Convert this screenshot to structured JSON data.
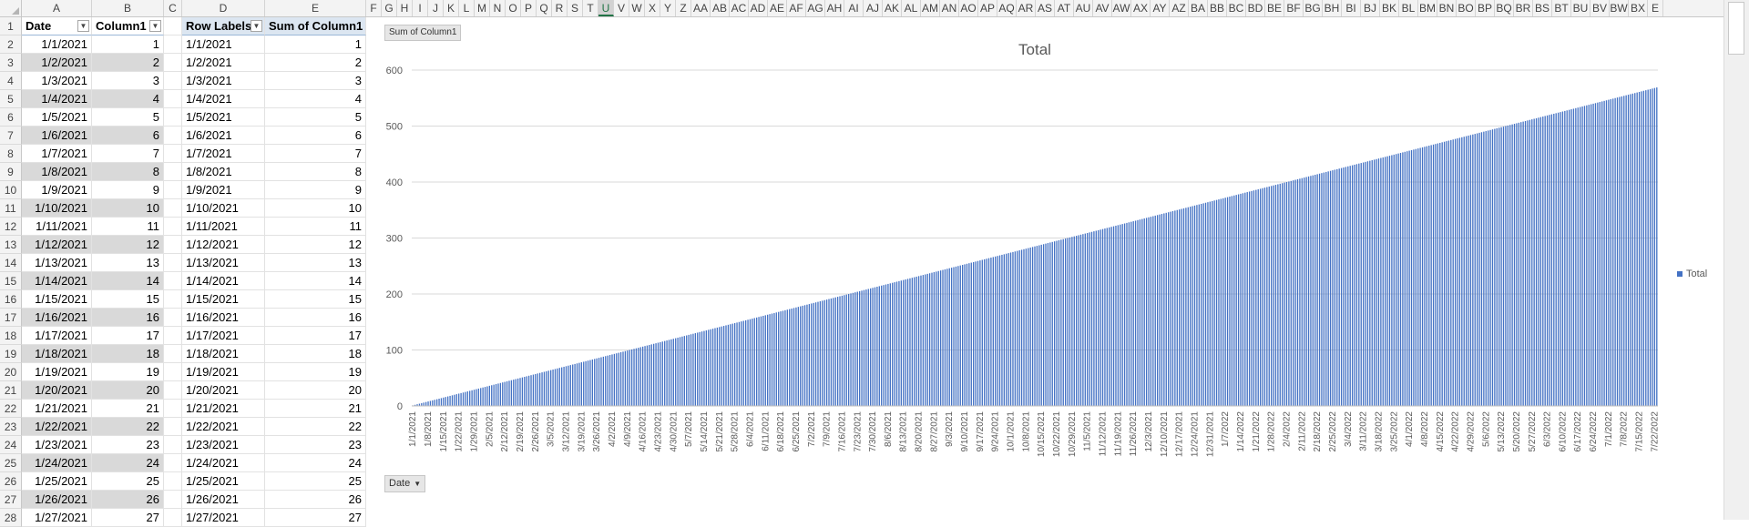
{
  "grid": {
    "columns": [
      "A",
      "B",
      "C",
      "D",
      "E",
      "F",
      "G",
      "H",
      "I",
      "J",
      "K",
      "L",
      "M",
      "N",
      "O",
      "P",
      "Q",
      "R",
      "S",
      "T",
      "U",
      "V",
      "W",
      "X",
      "Y",
      "Z",
      "AA",
      "AB",
      "AC",
      "AD",
      "AE",
      "AF",
      "AG",
      "AH",
      "AI",
      "AJ",
      "AK",
      "AL",
      "AM",
      "AN",
      "AO",
      "AP",
      "AQ",
      "AR",
      "AS",
      "AT",
      "AU",
      "AV",
      "AW",
      "AX",
      "AY",
      "AZ",
      "BA",
      "BB",
      "BC",
      "BD",
      "BE",
      "BF",
      "BG",
      "BH",
      "BI",
      "BJ",
      "BK",
      "BL",
      "BM",
      "BN",
      "BO",
      "BP",
      "BQ",
      "BR",
      "BS",
      "BT",
      "BU",
      "BV",
      "BW",
      "BX",
      "E"
    ],
    "selected_column": "U"
  },
  "table": {
    "header_date": "Date",
    "header_col1": "Column1",
    "rows": [
      {
        "date": "1/1/2021",
        "v": "1"
      },
      {
        "date": "1/2/2021",
        "v": "2"
      },
      {
        "date": "1/3/2021",
        "v": "3"
      },
      {
        "date": "1/4/2021",
        "v": "4"
      },
      {
        "date": "1/5/2021",
        "v": "5"
      },
      {
        "date": "1/6/2021",
        "v": "6"
      },
      {
        "date": "1/7/2021",
        "v": "7"
      },
      {
        "date": "1/8/2021",
        "v": "8"
      },
      {
        "date": "1/9/2021",
        "v": "9"
      },
      {
        "date": "1/10/2021",
        "v": "10"
      },
      {
        "date": "1/11/2021",
        "v": "11"
      },
      {
        "date": "1/12/2021",
        "v": "12"
      },
      {
        "date": "1/13/2021",
        "v": "13"
      },
      {
        "date": "1/14/2021",
        "v": "14"
      },
      {
        "date": "1/15/2021",
        "v": "15"
      },
      {
        "date": "1/16/2021",
        "v": "16"
      },
      {
        "date": "1/17/2021",
        "v": "17"
      },
      {
        "date": "1/18/2021",
        "v": "18"
      },
      {
        "date": "1/19/2021",
        "v": "19"
      },
      {
        "date": "1/20/2021",
        "v": "20"
      },
      {
        "date": "1/21/2021",
        "v": "21"
      },
      {
        "date": "1/22/2021",
        "v": "22"
      },
      {
        "date": "1/23/2021",
        "v": "23"
      },
      {
        "date": "1/24/2021",
        "v": "24"
      },
      {
        "date": "1/25/2021",
        "v": "25"
      },
      {
        "date": "1/26/2021",
        "v": "26"
      },
      {
        "date": "1/27/2021",
        "v": "27"
      }
    ]
  },
  "pivot": {
    "header_labels": "Row Labels",
    "header_sum": "Sum of Column1"
  },
  "chart_fields": {
    "values_button": "Sum of Column1",
    "axis_button": "Date"
  },
  "chart_data": {
    "type": "bar",
    "title": "Total",
    "legend": "Total",
    "legend_position": "right",
    "series": [
      {
        "name": "Total",
        "values": "y = day index, rising linearly from 1 on 1/1/2021 to 569 on 7/23/2022"
      }
    ],
    "x": {
      "start": "1/1/2021",
      "end": "7/23/2022",
      "count": 569
    },
    "ylim": [
      0,
      600
    ],
    "yticks": [
      "0",
      "100",
      "200",
      "300",
      "400",
      "500",
      "600"
    ],
    "xtick_labels": [
      "1/1/2021",
      "1/8/2021",
      "1/15/2021",
      "1/22/2021",
      "1/29/2021",
      "2/5/2021",
      "2/12/2021",
      "2/19/2021",
      "2/26/2021",
      "3/5/2021",
      "3/12/2021",
      "3/19/2021",
      "3/26/2021",
      "4/2/2021",
      "4/9/2021",
      "4/16/2021",
      "4/23/2021",
      "4/30/2021",
      "5/7/2021",
      "5/14/2021",
      "5/21/2021",
      "5/28/2021",
      "6/4/2021",
      "6/11/2021",
      "6/18/2021",
      "6/25/2021",
      "7/2/2021",
      "7/9/2021",
      "7/16/2021",
      "7/23/2021",
      "7/30/2021",
      "8/6/2021",
      "8/13/2021",
      "8/20/2021",
      "8/27/2021",
      "9/3/2021",
      "9/10/2021",
      "9/17/2021",
      "9/24/2021",
      "10/1/2021",
      "10/8/2021",
      "10/15/2021",
      "10/22/2021",
      "10/29/2021",
      "11/5/2021",
      "11/12/2021",
      "11/19/2021",
      "11/26/2021",
      "12/3/2021",
      "12/10/2021",
      "12/17/2021",
      "12/24/2021",
      "12/31/2021",
      "1/7/2022",
      "1/14/2022",
      "1/21/2022",
      "1/28/2022",
      "2/4/2022",
      "2/11/2022",
      "2/18/2022",
      "2/25/2022",
      "3/4/2022",
      "3/11/2022",
      "3/18/2022",
      "3/25/2022",
      "4/1/2022",
      "4/8/2022",
      "4/15/2022",
      "4/22/2022",
      "4/29/2022",
      "5/6/2022",
      "5/13/2022",
      "5/20/2022",
      "5/27/2022",
      "6/3/2022",
      "6/10/2022",
      "6/17/2022",
      "6/24/2022",
      "7/1/2022",
      "7/8/2022",
      "7/15/2022",
      "7/22/2022"
    ],
    "grid": true,
    "bar_color": "#4472c4"
  }
}
